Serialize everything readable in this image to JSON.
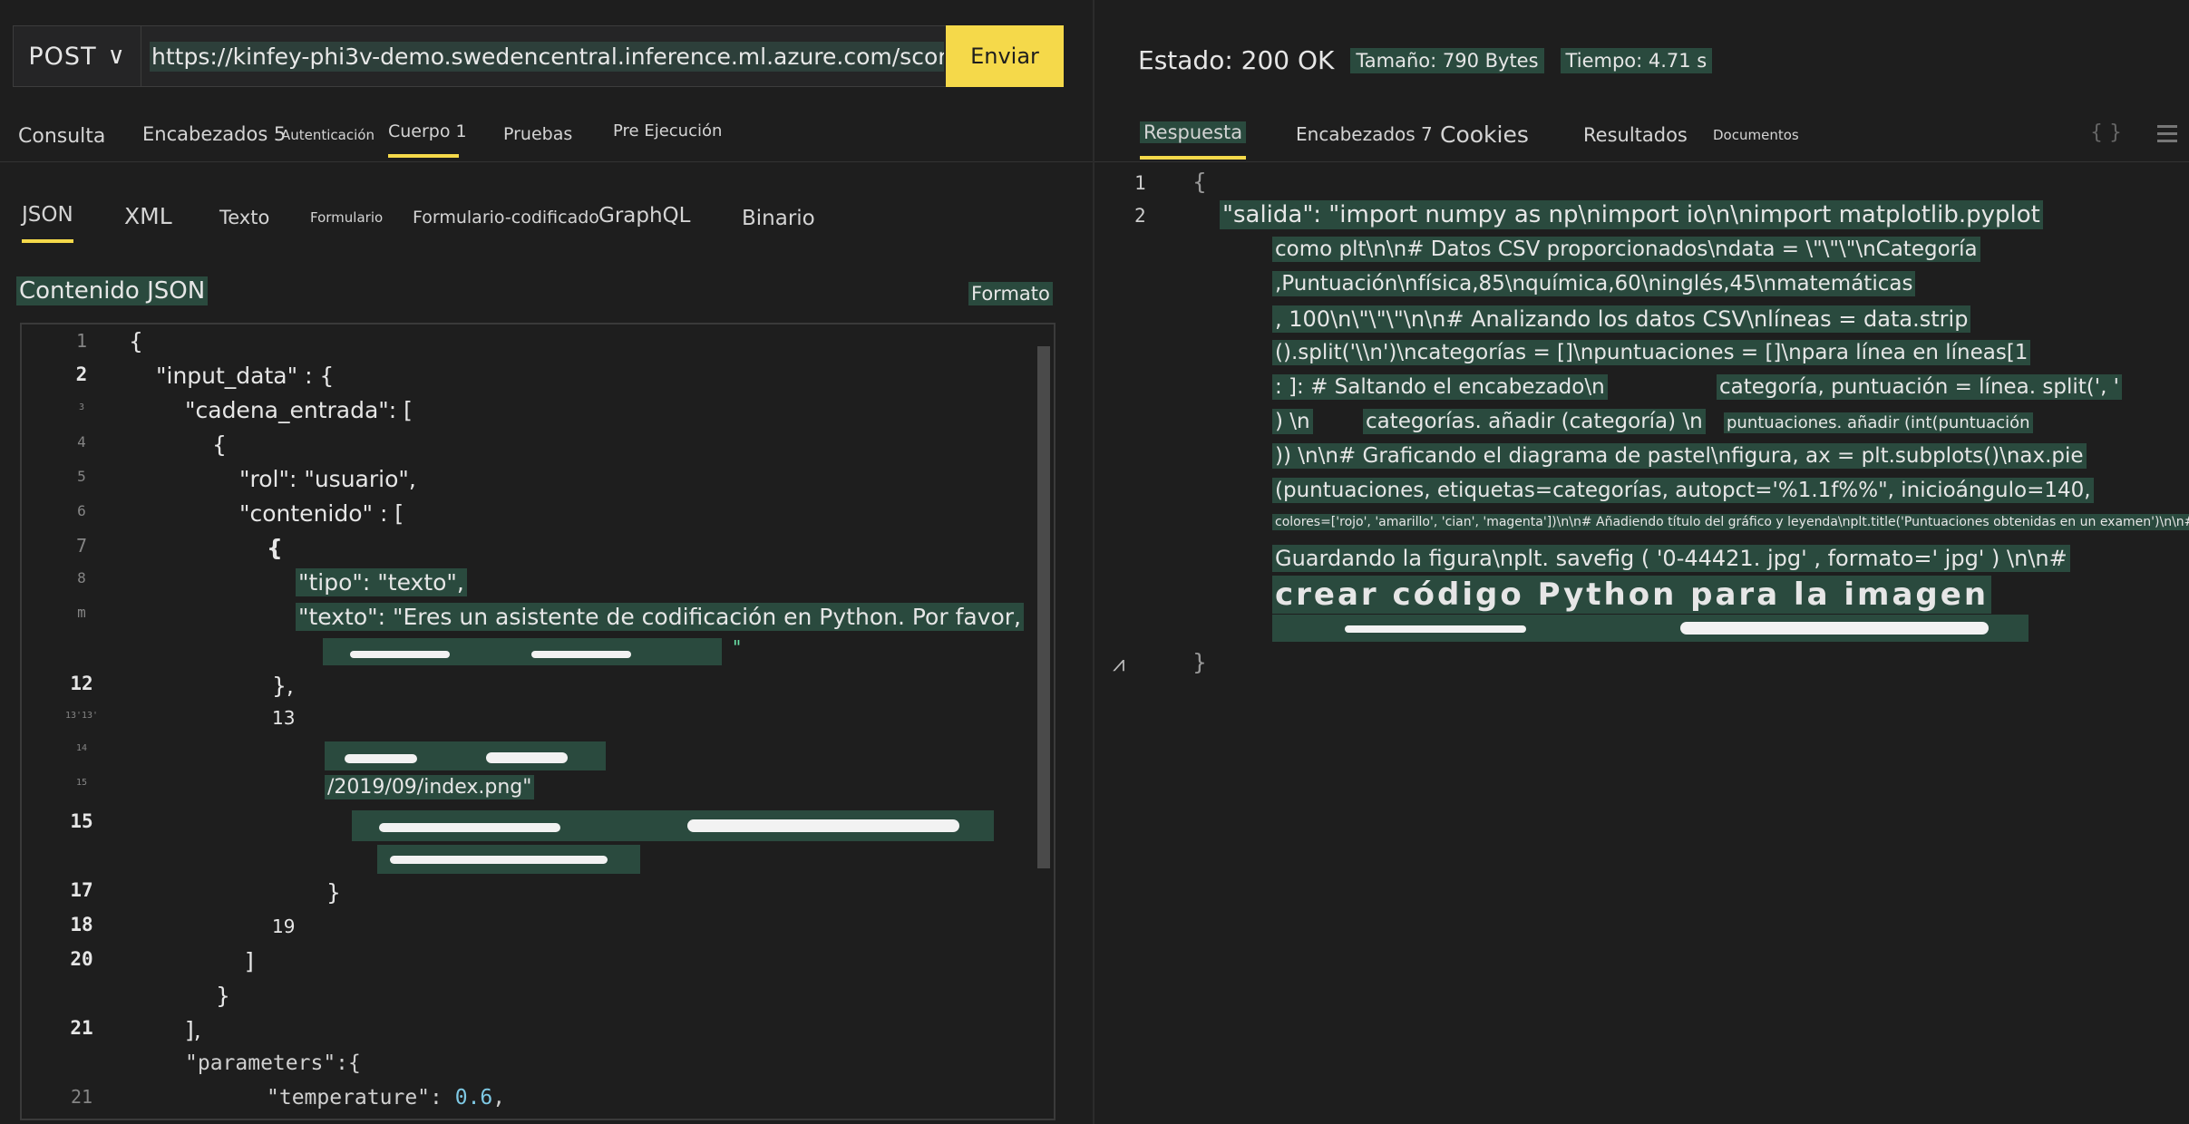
{
  "request": {
    "method": "POST",
    "url": "https://kinfey-phi3v-demo.swedencentral.inference.ml.azure.com/score",
    "send_label": "Enviar"
  },
  "request_tabs": [
    "Consulta",
    "Encabezados 5",
    "Autenticación",
    "Cuerpo 1",
    "Pruebas",
    "Pre Ejecución"
  ],
  "body_tabs": [
    "JSON",
    "XML",
    "Texto",
    "Formulario",
    "Formulario-codificado",
    "GraphQL",
    "Binario"
  ],
  "json_content_label": "Contenido JSON",
  "format_label": "Formato",
  "line_numbers": [
    "1",
    "2",
    "3",
    "4",
    "5",
    "6",
    "7",
    "8",
    "m",
    "",
    "12",
    "13'13'",
    "14",
    "15",
    "15",
    "",
    "17",
    "18",
    "20",
    "",
    "21",
    "",
    "21"
  ],
  "code_lines": {
    "l1": "{",
    "l2": "\"input_data\" : {",
    "l3": "\"cadena_entrada\": [",
    "l4": "{",
    "l5": "\"rol\": \"usuario\",",
    "l6": "\"contenido\" : [",
    "l7": "{",
    "l8": "\"tipo\": \"texto\",",
    "l9": "\"texto\": \"Eres un asistente de codificación en Python. Por favor,",
    "l9b": "\"",
    "l12": "},",
    "l13": "13",
    "l14b": "/2019/09/index.png\"",
    "l17": "}",
    "l18": "19",
    "l20": "]",
    "l20b": "}",
    "l21": "],",
    "l22": "\"parameters\":{",
    "l23a": "\"temperature\": ",
    "l23b": "0.6",
    "l23c": ","
  },
  "response": {
    "status": "Estado: 200 OK",
    "size": "Tamaño: 790 Bytes",
    "time": "Tiempo: 4.71 s",
    "tabs": [
      "Respuesta",
      "Encabezados 7",
      "Cookies",
      "Resultados",
      "Documentos"
    ],
    "line1": "{",
    "line2": "\"salida\": \"import numpy as np\\nimport io\\n\\nimport matplotlib.pyplot",
    "wrap1": "como plt\\n\\n# Datos CSV proporcionados\\ndata = \\\"\\\"\\\"\\nCategoría",
    "wrap2": ",Puntuación\\nfísica,85\\nquímica,60\\ninglés,45\\nmatemáticas",
    "wrap3": ", 100\\n\\\"\\\"\\\"\\n\\n# Analizando los datos CSV\\nlíneas = data.strip",
    "wrap4": "().split('\\\\n')\\ncategorías = []\\npuntuaciones = []\\npara línea en líneas[1",
    "wrap5a": ": ]: # Saltando el encabezado\\n",
    "wrap5b": "categoría, puntuación = línea. split(', '",
    "wrap6a": ") \\n",
    "wrap6b": "categorías. añadir (categoría) \\n",
    "wrap6c": "puntuaciones. añadir (int(puntuación",
    "wrap7": ")) \\n\\n# Graficando el diagrama de pastel\\nfigura, ax = plt.subplots()\\nax.pie",
    "wrap8": "(puntuaciones, etiquetas=categorías, autopct='%1.1f%%\", inicioángulo=140,",
    "wrap9": "colores=['rojo', 'amarillo', 'cian', 'magenta'])\\n\\n# Añadiendo título del gráfico y leyenda\\nplt.title('Puntuaciones obtenidas en un examen')\\n\\n#",
    "wrap10": "Guardando la figura\\nplt. savefig ( '0-44421. jpg' , formato=' jpg' ) \\n\\n#",
    "wrap11": "crear código Python para la imagen",
    "close": "}"
  },
  "icons": {
    "braces": "braces-icon",
    "menu": "menu-icon",
    "pointer": "pointer-icon"
  },
  "colors": {
    "accent": "#f5d94a",
    "highlight": "#2a4a3e",
    "background": "#1e1e1e"
  }
}
